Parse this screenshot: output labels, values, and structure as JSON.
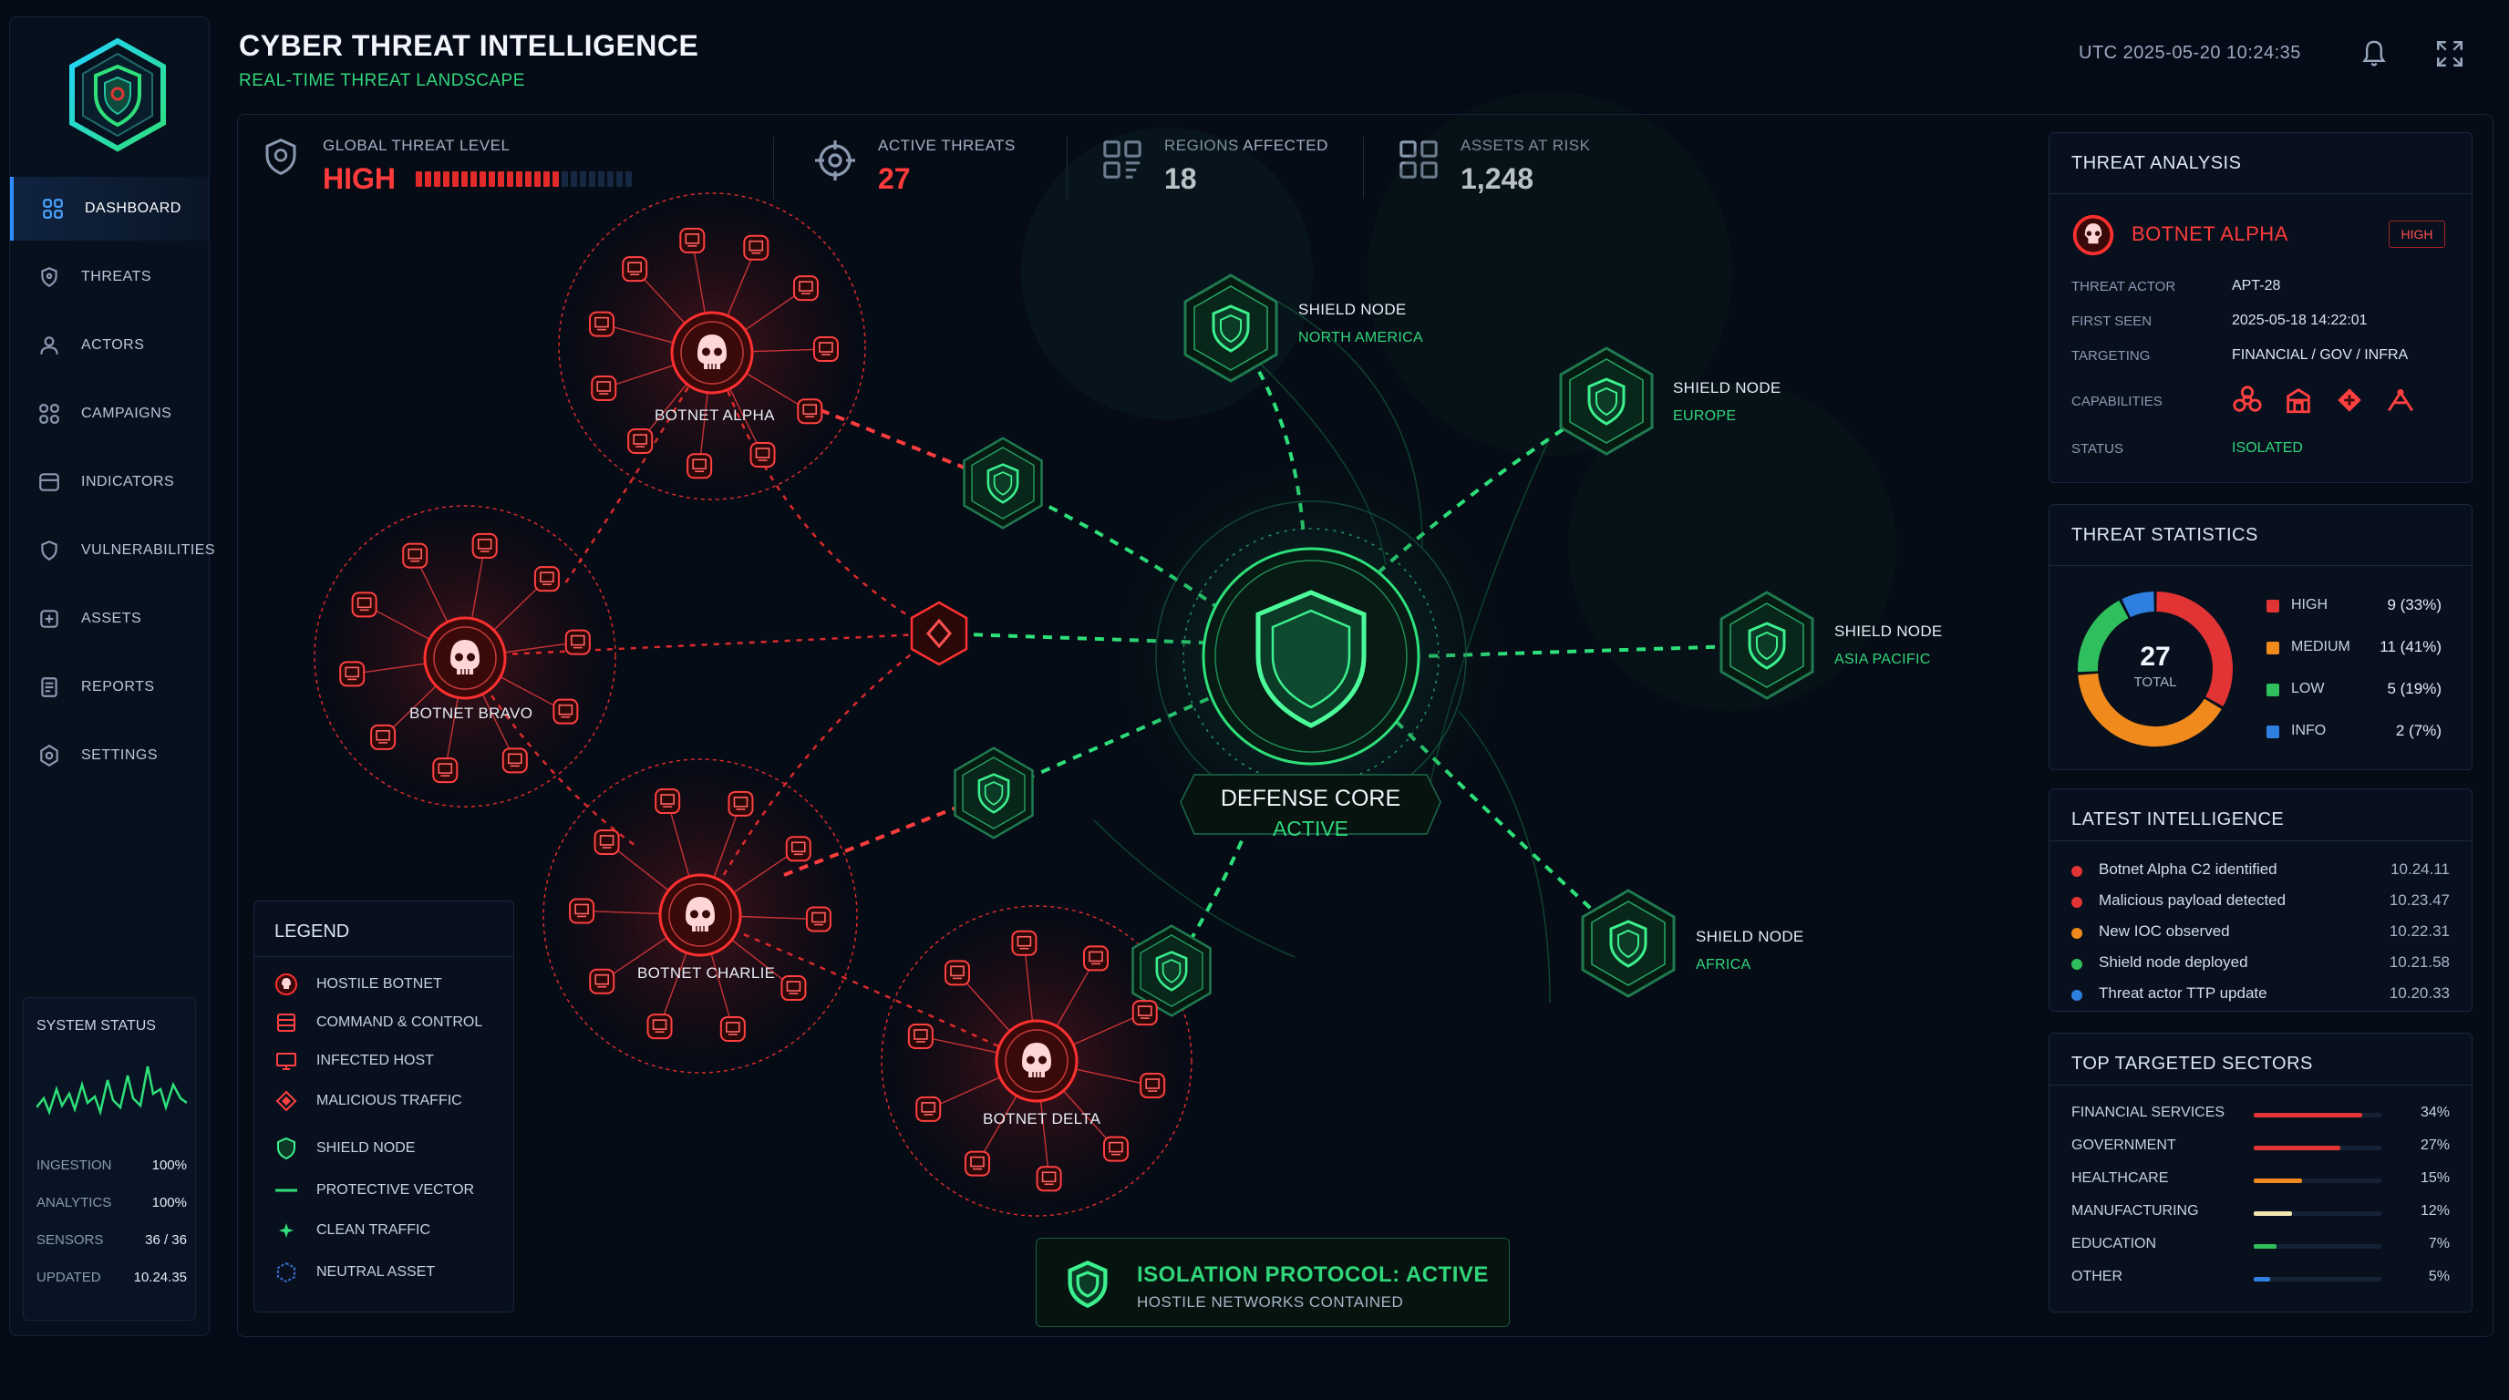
{
  "header": {
    "title": "CYBER THREAT INTELLIGENCE",
    "subtitle": "REAL-TIME THREAT LANDSCAPE",
    "clock": "UTC 2025-05-20 10:24:35"
  },
  "sidebar": {
    "items": [
      {
        "label": "DASHBOARD",
        "icon": "grid-icon",
        "active": true
      },
      {
        "label": "THREATS",
        "icon": "radar-icon",
        "active": false
      },
      {
        "label": "ACTORS",
        "icon": "user-icon",
        "active": false
      },
      {
        "label": "CAMPAIGNS",
        "icon": "link-icon",
        "active": false
      },
      {
        "label": "INDICATORS",
        "icon": "tag-icon",
        "active": false
      },
      {
        "label": "VULNERABILITIES",
        "icon": "shield-icon",
        "active": false
      },
      {
        "label": "ASSETS",
        "icon": "box-icon",
        "active": false
      },
      {
        "label": "REPORTS",
        "icon": "document-icon",
        "active": false
      },
      {
        "label": "SETTINGS",
        "icon": "gear-icon",
        "active": false
      }
    ],
    "system_status": {
      "title": "SYSTEM STATUS",
      "rows": [
        {
          "key": "INGESTION",
          "value": "100%"
        },
        {
          "key": "ANALYTICS",
          "value": "100%"
        },
        {
          "key": "SENSORS",
          "value": "36 / 36"
        },
        {
          "key": "UPDATED",
          "value": "10.24.35"
        }
      ]
    }
  },
  "stats": {
    "threat_level": {
      "label": "GLOBAL THREAT LEVEL",
      "value": "HIGH",
      "segments_total": 24,
      "segments_filled": 16
    },
    "active_threats": {
      "label": "ACTIVE THREATS",
      "value": "27"
    },
    "regions": {
      "label": "REGIONS AFFECTED",
      "value": "18"
    },
    "assets": {
      "label": "ASSETS AT RISK",
      "value": "1,248"
    }
  },
  "network": {
    "core": {
      "label": "DEFENSE CORE",
      "status": "ACTIVE"
    },
    "shield_nodes": [
      {
        "label": "SHIELD NODE",
        "region": "NORTH AMERICA"
      },
      {
        "label": "SHIELD NODE",
        "region": "EUROPE"
      },
      {
        "label": "SHIELD NODE",
        "region": "ASIA PACIFIC"
      },
      {
        "label": "SHIELD NODE",
        "region": "AFRICA"
      }
    ],
    "botnets": [
      "BOTNET ALPHA",
      "BOTNET BRAVO",
      "BOTNET CHARLIE",
      "BOTNET DELTA"
    ],
    "banner": {
      "title": "ISOLATION PROTOCOL: ACTIVE",
      "subtitle": "HOSTILE NETWORKS CONTAINED"
    }
  },
  "legend": {
    "title": "LEGEND",
    "items": [
      "HOSTILE BOTNET",
      "COMMAND & CONTROL",
      "INFECTED HOST",
      "MALICIOUS TRAFFIC",
      "SHIELD NODE",
      "PROTECTIVE VECTOR",
      "CLEAN TRAFFIC",
      "NEUTRAL ASSET"
    ]
  },
  "threat_analysis": {
    "title": "THREAT ANALYSIS",
    "name": "BOTNET ALPHA",
    "severity": "HIGH",
    "fields": [
      {
        "key": "THREAT ACTOR",
        "value": "APT-28"
      },
      {
        "key": "FIRST SEEN",
        "value": "2025-05-18 14:22:01"
      },
      {
        "key": "TARGETING",
        "value": "FINANCIAL / GOV / INFRA"
      },
      {
        "key": "CAPABILITIES",
        "value": ""
      },
      {
        "key": "STATUS",
        "value": "ISOLATED"
      }
    ]
  },
  "threat_statistics": {
    "title": "THREAT STATISTICS",
    "total": "27",
    "total_label": "TOTAL",
    "rows": [
      {
        "name": "HIGH",
        "value": "9 (33%)",
        "count": 9,
        "color": "#e23434"
      },
      {
        "name": "MEDIUM",
        "value": "11 (41%)",
        "count": 11,
        "color": "#f08a1c"
      },
      {
        "name": "LOW",
        "value": "5 (19%)",
        "count": 5,
        "color": "#2fbf5c"
      },
      {
        "name": "INFO",
        "value": "2 (7%)",
        "count": 2,
        "color": "#2f7fe0"
      }
    ]
  },
  "latest_intelligence": {
    "title": "LATEST INTELLIGENCE",
    "rows": [
      {
        "text": "Botnet Alpha C2 identified",
        "time": "10.24.11",
        "color": "#e23434"
      },
      {
        "text": "Malicious payload detected",
        "time": "10.23.47",
        "color": "#e23434"
      },
      {
        "text": "New IOC observed",
        "time": "10.22.31",
        "color": "#f08a1c"
      },
      {
        "text": "Shield node deployed",
        "time": "10.21.58",
        "color": "#2fbf5c"
      },
      {
        "text": "Threat actor TTP update",
        "time": "10.20.33",
        "color": "#2f7fe0"
      }
    ]
  },
  "top_sectors": {
    "title": "TOP TARGETED SECTORS",
    "rows": [
      {
        "name": "FINANCIAL SERVICES",
        "pct": "34%",
        "value": 34,
        "color": "#e23434"
      },
      {
        "name": "GOVERNMENT",
        "pct": "27%",
        "value": 27,
        "color": "#e23434"
      },
      {
        "name": "HEALTHCARE",
        "pct": "15%",
        "value": 15,
        "color": "#f08a1c"
      },
      {
        "name": "MANUFACTURING",
        "pct": "12%",
        "value": 12,
        "color": "#f5e6b0"
      },
      {
        "name": "EDUCATION",
        "pct": "7%",
        "value": 7,
        "color": "#2fbf5c"
      },
      {
        "name": "OTHER",
        "pct": "5%",
        "value": 5,
        "color": "#2f7fe0"
      }
    ]
  }
}
